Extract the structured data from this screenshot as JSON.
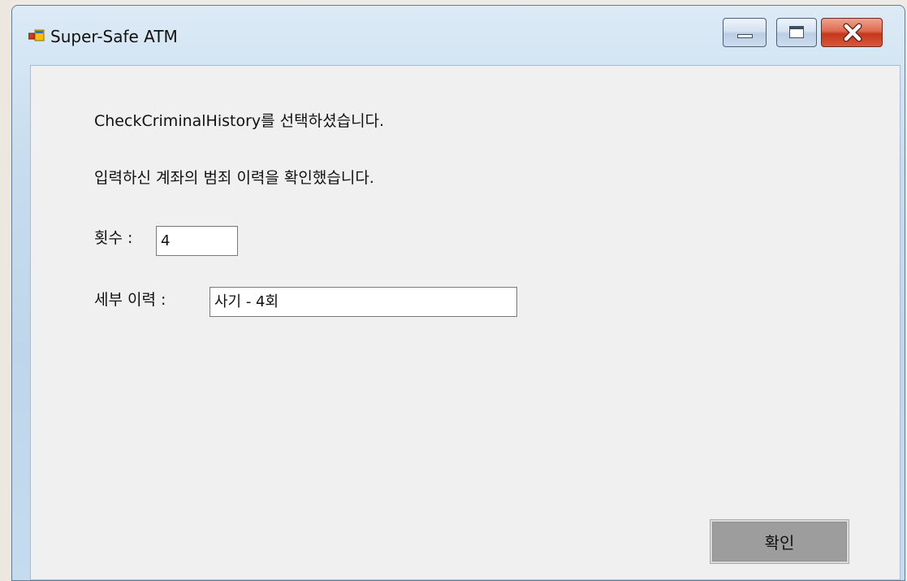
{
  "window": {
    "title": "Super-Safe ATM"
  },
  "dialog": {
    "message_selected": "CheckCriminalHistory를 선택하셨습니다.",
    "message_result": "입력하신 계좌의 범죄 이력을 확인했습니다.",
    "count_label": "횟수 :",
    "count_value": "4",
    "detail_label": "세부 이력 :",
    "detail_value": "사기 - 4회",
    "confirm_label": "확인"
  },
  "colors": {
    "client_background": "#f0f0f0",
    "confirm_button": "#9d9d9d",
    "close_button": "#c4381b"
  },
  "icons": {
    "app": "app-window-icon",
    "minimize": "minimize-icon",
    "maximize": "maximize-icon",
    "close": "close-icon"
  }
}
